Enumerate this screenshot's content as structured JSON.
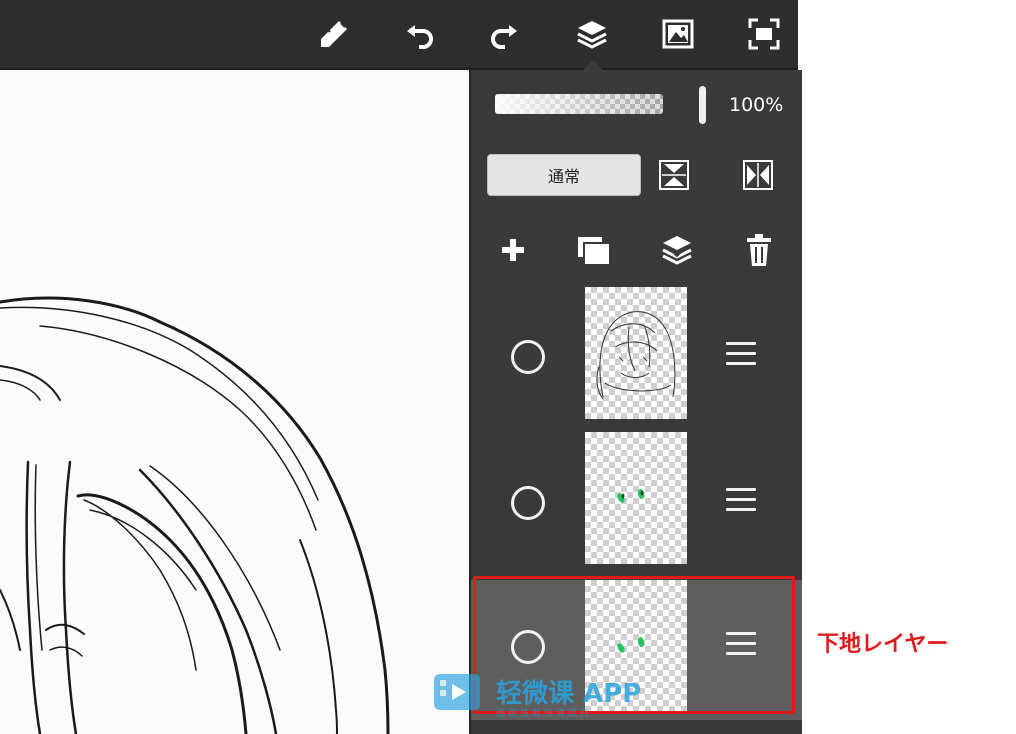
{
  "toolbar": {
    "items": [
      {
        "name": "brush-settings-icon"
      },
      {
        "name": "undo-icon"
      },
      {
        "name": "redo-icon"
      },
      {
        "name": "layers-icon"
      },
      {
        "name": "image-icon"
      },
      {
        "name": "fullscreen-icon"
      }
    ],
    "active": "layers-icon"
  },
  "layer_panel": {
    "opacity": {
      "value": 1.0,
      "label": "100%"
    },
    "blend_mode": {
      "label": "通常"
    },
    "blend_actions": [
      "flip-vertical-icon",
      "flip-horizontal-icon"
    ],
    "layer_actions": [
      "add-layer-icon",
      "duplicate-layer-icon",
      "merge-down-icon",
      "delete-layer-icon"
    ],
    "layers": [
      {
        "thumbnail": "line-art",
        "selected": false
      },
      {
        "thumbnail": "green-dots",
        "selected": false
      },
      {
        "thumbnail": "green-dots",
        "selected": true
      }
    ]
  },
  "annotation": {
    "label": "下地レイヤー",
    "color": "#e01b1b"
  },
  "watermark": {
    "text": "轻微课 APP",
    "sub": "画画技能快速提升"
  },
  "colors": {
    "toolbar_bg": "#2e2e2e",
    "panel_bg": "#3a3a3a",
    "selected_row": "#5e5e5e",
    "highlight": "#e01b1b",
    "accent_dots": "#22c55e"
  }
}
